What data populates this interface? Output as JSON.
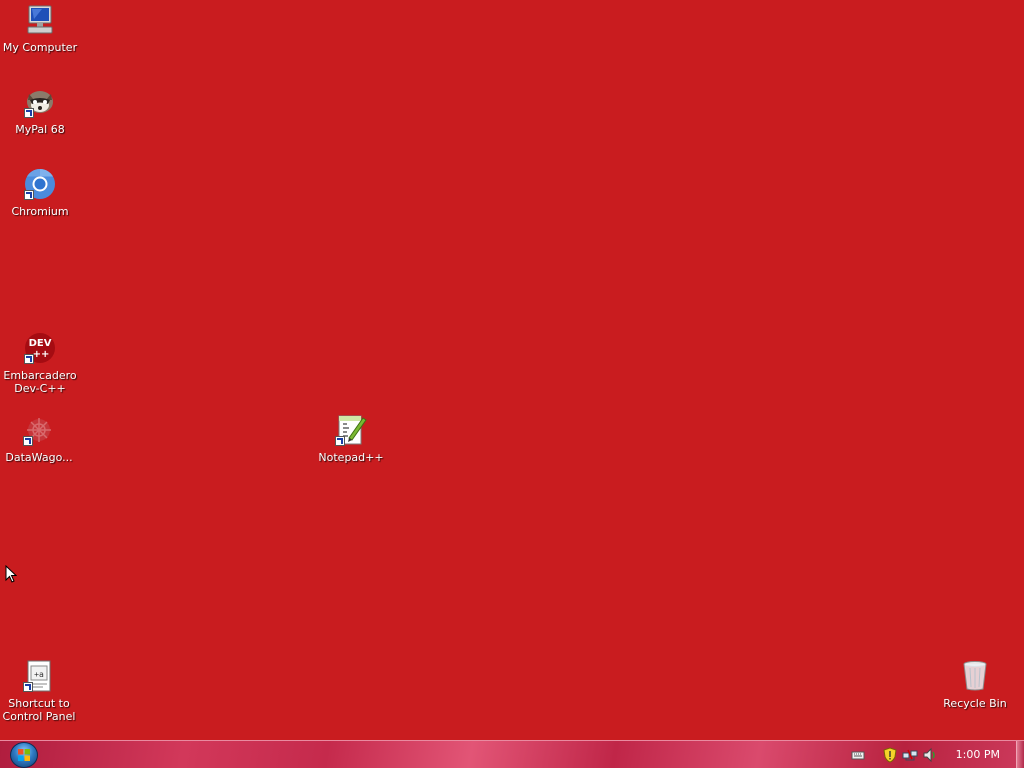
{
  "desktop": {
    "background_color": "#c91c1f",
    "icons": [
      {
        "label": "My Computer",
        "icon": "computer-icon",
        "shortcut": false
      },
      {
        "label": "MyPal 68",
        "icon": "raccoon-icon",
        "shortcut": true
      },
      {
        "label": "Chromium",
        "icon": "chromium-icon",
        "shortcut": true
      },
      {
        "label": "Embarcadero Dev-C++",
        "icon": "devcpp-icon",
        "shortcut": true
      },
      {
        "label": "DataWago...",
        "icon": "datawagon-icon",
        "shortcut": true
      },
      {
        "label": "Notepad++",
        "icon": "notepadpp-icon",
        "shortcut": true
      },
      {
        "label": "Shortcut to Control Panel",
        "icon": "control-panel-icon",
        "shortcut": true
      },
      {
        "label": "Recycle Bin",
        "icon": "recycle-bin-icon",
        "shortcut": false
      }
    ]
  },
  "taskbar": {
    "start_icon": "windows-flag-icon",
    "tray_icons": [
      "keyboard-icon",
      "shield-warning-icon",
      "network-icon",
      "volume-icon"
    ],
    "clock": "1:00 PM"
  }
}
